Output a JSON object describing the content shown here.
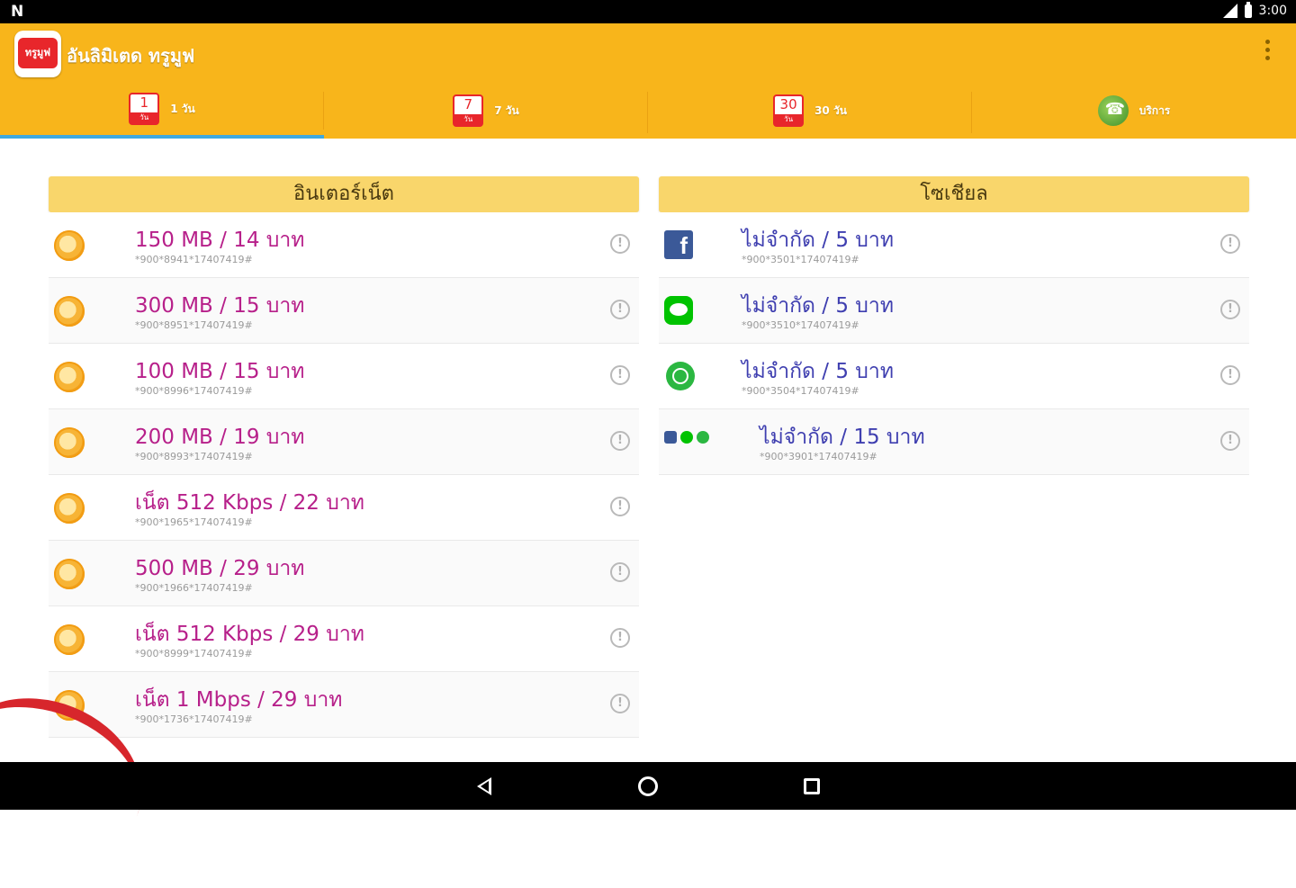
{
  "status": {
    "carrier": "N",
    "time": "3:00"
  },
  "app": {
    "title": "อันลิมิเตด ทรูมูฟ",
    "logo_text": "ทรูมูฟ"
  },
  "tabs": [
    {
      "icon_number": "1",
      "label": "1 วัน",
      "icon": "calendar-icon",
      "active": true
    },
    {
      "icon_number": "7",
      "label": "7 วัน",
      "icon": "calendar-icon",
      "active": false
    },
    {
      "icon_number": "30",
      "label": "30 วัน",
      "icon": "calendar-icon",
      "active": false
    },
    {
      "icon_number": "",
      "label": "บริการ",
      "icon": "phone-icon",
      "active": false
    }
  ],
  "internet": {
    "header": "อินเตอร์เน็ต",
    "items": [
      {
        "title": "150 MB / 14 บาท",
        "code": "*900*8941*17407419#"
      },
      {
        "title": "300 MB / 15 บาท",
        "code": "*900*8951*17407419#"
      },
      {
        "title": "100 MB / 15 บาท",
        "code": "*900*8996*17407419#"
      },
      {
        "title": "200 MB / 19 บาท",
        "code": "*900*8993*17407419#"
      },
      {
        "title": "เน็ต 512 Kbps / 22 บาท",
        "code": "*900*1965*17407419#"
      },
      {
        "title": "500 MB / 29 บาท",
        "code": "*900*1966*17407419#"
      },
      {
        "title": "เน็ต 512 Kbps / 29 บาท",
        "code": "*900*8999*17407419#"
      },
      {
        "title": "เน็ต 1 Mbps / 29 บาท",
        "code": "*900*1736*17407419#"
      }
    ]
  },
  "social": {
    "header": "โซเชียล",
    "items": [
      {
        "title": "ไม่จำกัด / 5 บาท",
        "code": "*900*3501*17407419#",
        "icon": "facebook-icon"
      },
      {
        "title": "ไม่จำกัด / 5 บาท",
        "code": "*900*3510*17407419#",
        "icon": "line-icon"
      },
      {
        "title": "ไม่จำกัด / 5 บาท",
        "code": "*900*3504*17407419#",
        "icon": "whatsapp-icon"
      },
      {
        "title": "ไม่จำกัด / 15 บาท",
        "code": "*900*3901*17407419#",
        "icon": "multi-social-icon"
      }
    ]
  },
  "info_glyph": "!",
  "colors": {
    "primary": "#f8b51b",
    "header": "#f9d66b",
    "internet_text": "#b7208a",
    "social_text": "#3f3fb0",
    "tab_indicator": "#3fa9e0"
  }
}
